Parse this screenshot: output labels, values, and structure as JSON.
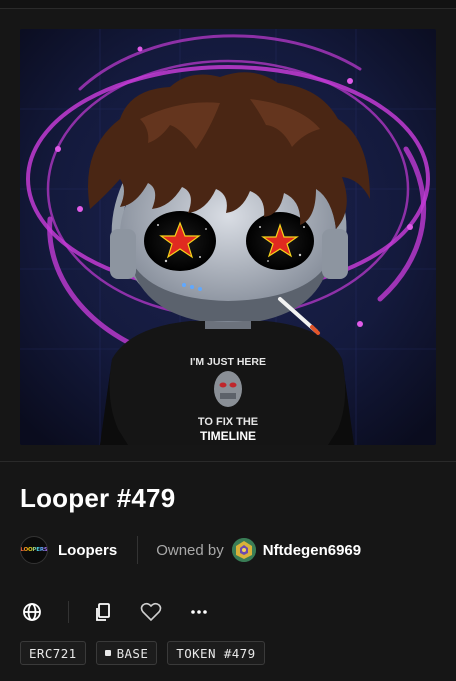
{
  "nft": {
    "shirt_line1": "I'M JUST HERE",
    "shirt_line2": "TO FIX THE",
    "shirt_line3": "TIMELINE",
    "title": "Looper #479"
  },
  "collection": {
    "logo_text": "LOOPERS",
    "name": "Loopers"
  },
  "owner": {
    "label": "Owned by",
    "name": "Nftdegen6969"
  },
  "actions": {
    "website": "globe-icon",
    "copy": "copy-icon",
    "favorite": "heart-icon",
    "more": "more-icon"
  },
  "tags": {
    "standard": "ERC721",
    "chain": "BASE",
    "token": "TOKEN #479"
  },
  "colors": {
    "background": "#121212",
    "ring": "#c23bd4",
    "star_red": "#e02a20",
    "star_yellow": "#f5d21a"
  }
}
